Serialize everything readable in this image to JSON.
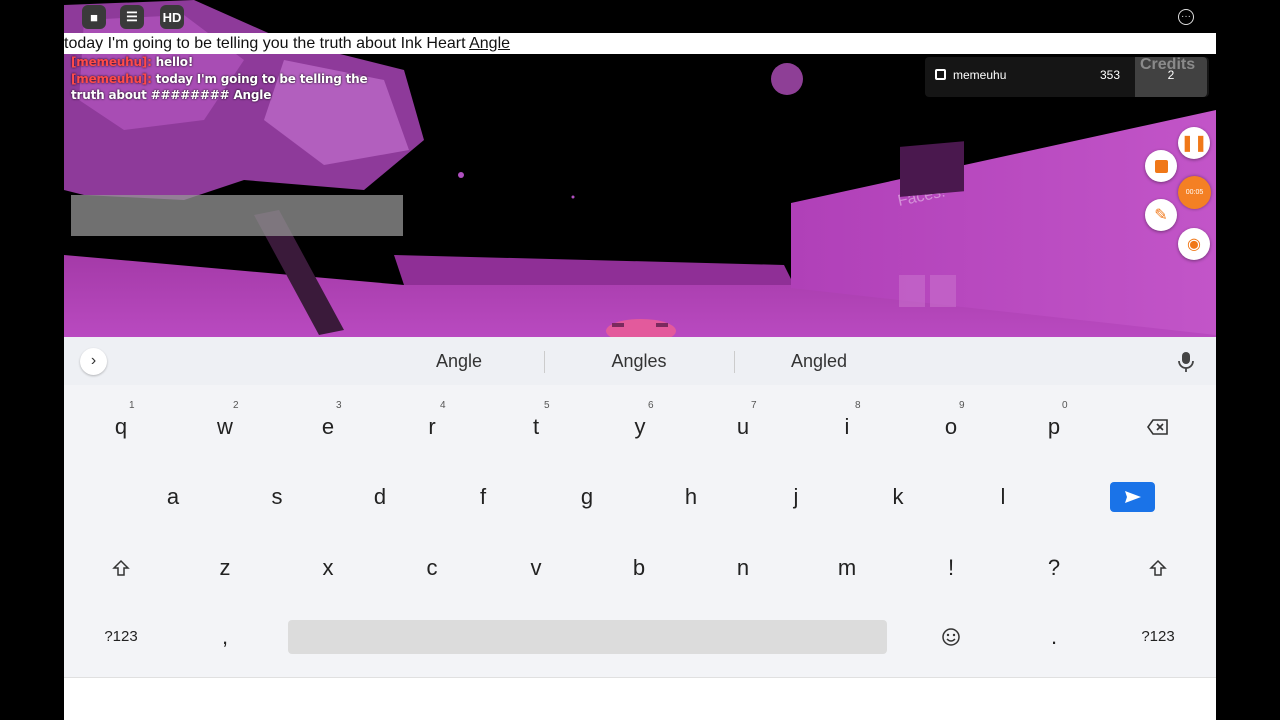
{
  "topbar": {
    "roblox_icon": "roblox-logo-icon",
    "chat_icon": "chat-icon",
    "hd_label": "HD",
    "more_icon": "more-options-icon",
    "more_label": "···"
  },
  "chat_input": {
    "text_before": "today I'm going to be telling you the truth about Ink Heart ",
    "text_underlined": "Angle"
  },
  "chat_log": [
    {
      "user": "[memeuhu]:",
      "message": "hello!"
    },
    {
      "user": "[memeuhu]:",
      "message": "today I'm going to be telling the truth about ######## Angle"
    }
  ],
  "leaderboard": {
    "column_header": "Credits",
    "player_name": "memeuhu",
    "player_value": "353",
    "credits_value": "2"
  },
  "recorder": {
    "timer": "00:05",
    "pause_icon": "pause-icon",
    "stop_icon": "stop-icon",
    "brush_icon": "brush-icon",
    "camera_icon": "camera-icon"
  },
  "keyboard": {
    "suggestions": [
      "Angle",
      "Angles",
      "Angled"
    ],
    "row1": [
      {
        "key": "q",
        "hint": "1"
      },
      {
        "key": "w",
        "hint": "2"
      },
      {
        "key": "e",
        "hint": "3"
      },
      {
        "key": "r",
        "hint": "4"
      },
      {
        "key": "t",
        "hint": "5"
      },
      {
        "key": "y",
        "hint": "6"
      },
      {
        "key": "u",
        "hint": "7"
      },
      {
        "key": "i",
        "hint": "8"
      },
      {
        "key": "o",
        "hint": "9"
      },
      {
        "key": "p",
        "hint": "0"
      }
    ],
    "row2": [
      "a",
      "s",
      "d",
      "f",
      "g",
      "h",
      "j",
      "k",
      "l"
    ],
    "row3": [
      "z",
      "x",
      "c",
      "v",
      "b",
      "n",
      "m",
      "!",
      "?"
    ],
    "row4": {
      "symbols_left": "?123",
      "comma": ",",
      "period": ".",
      "symbols_right": "?123"
    },
    "icons": {
      "expand": "chevron-right-icon",
      "mic": "microphone-icon",
      "backspace": "backspace-icon",
      "send": "send-icon",
      "shift": "shift-icon",
      "emoji": "emoji-icon"
    }
  },
  "colors": {
    "scene_magenta": "#b63fc4",
    "keyboard_bg": "#f3f4f7",
    "send_blue": "#1a73e8",
    "recorder_orange": "#f48024",
    "chat_user_red": "#ff4a4a"
  }
}
